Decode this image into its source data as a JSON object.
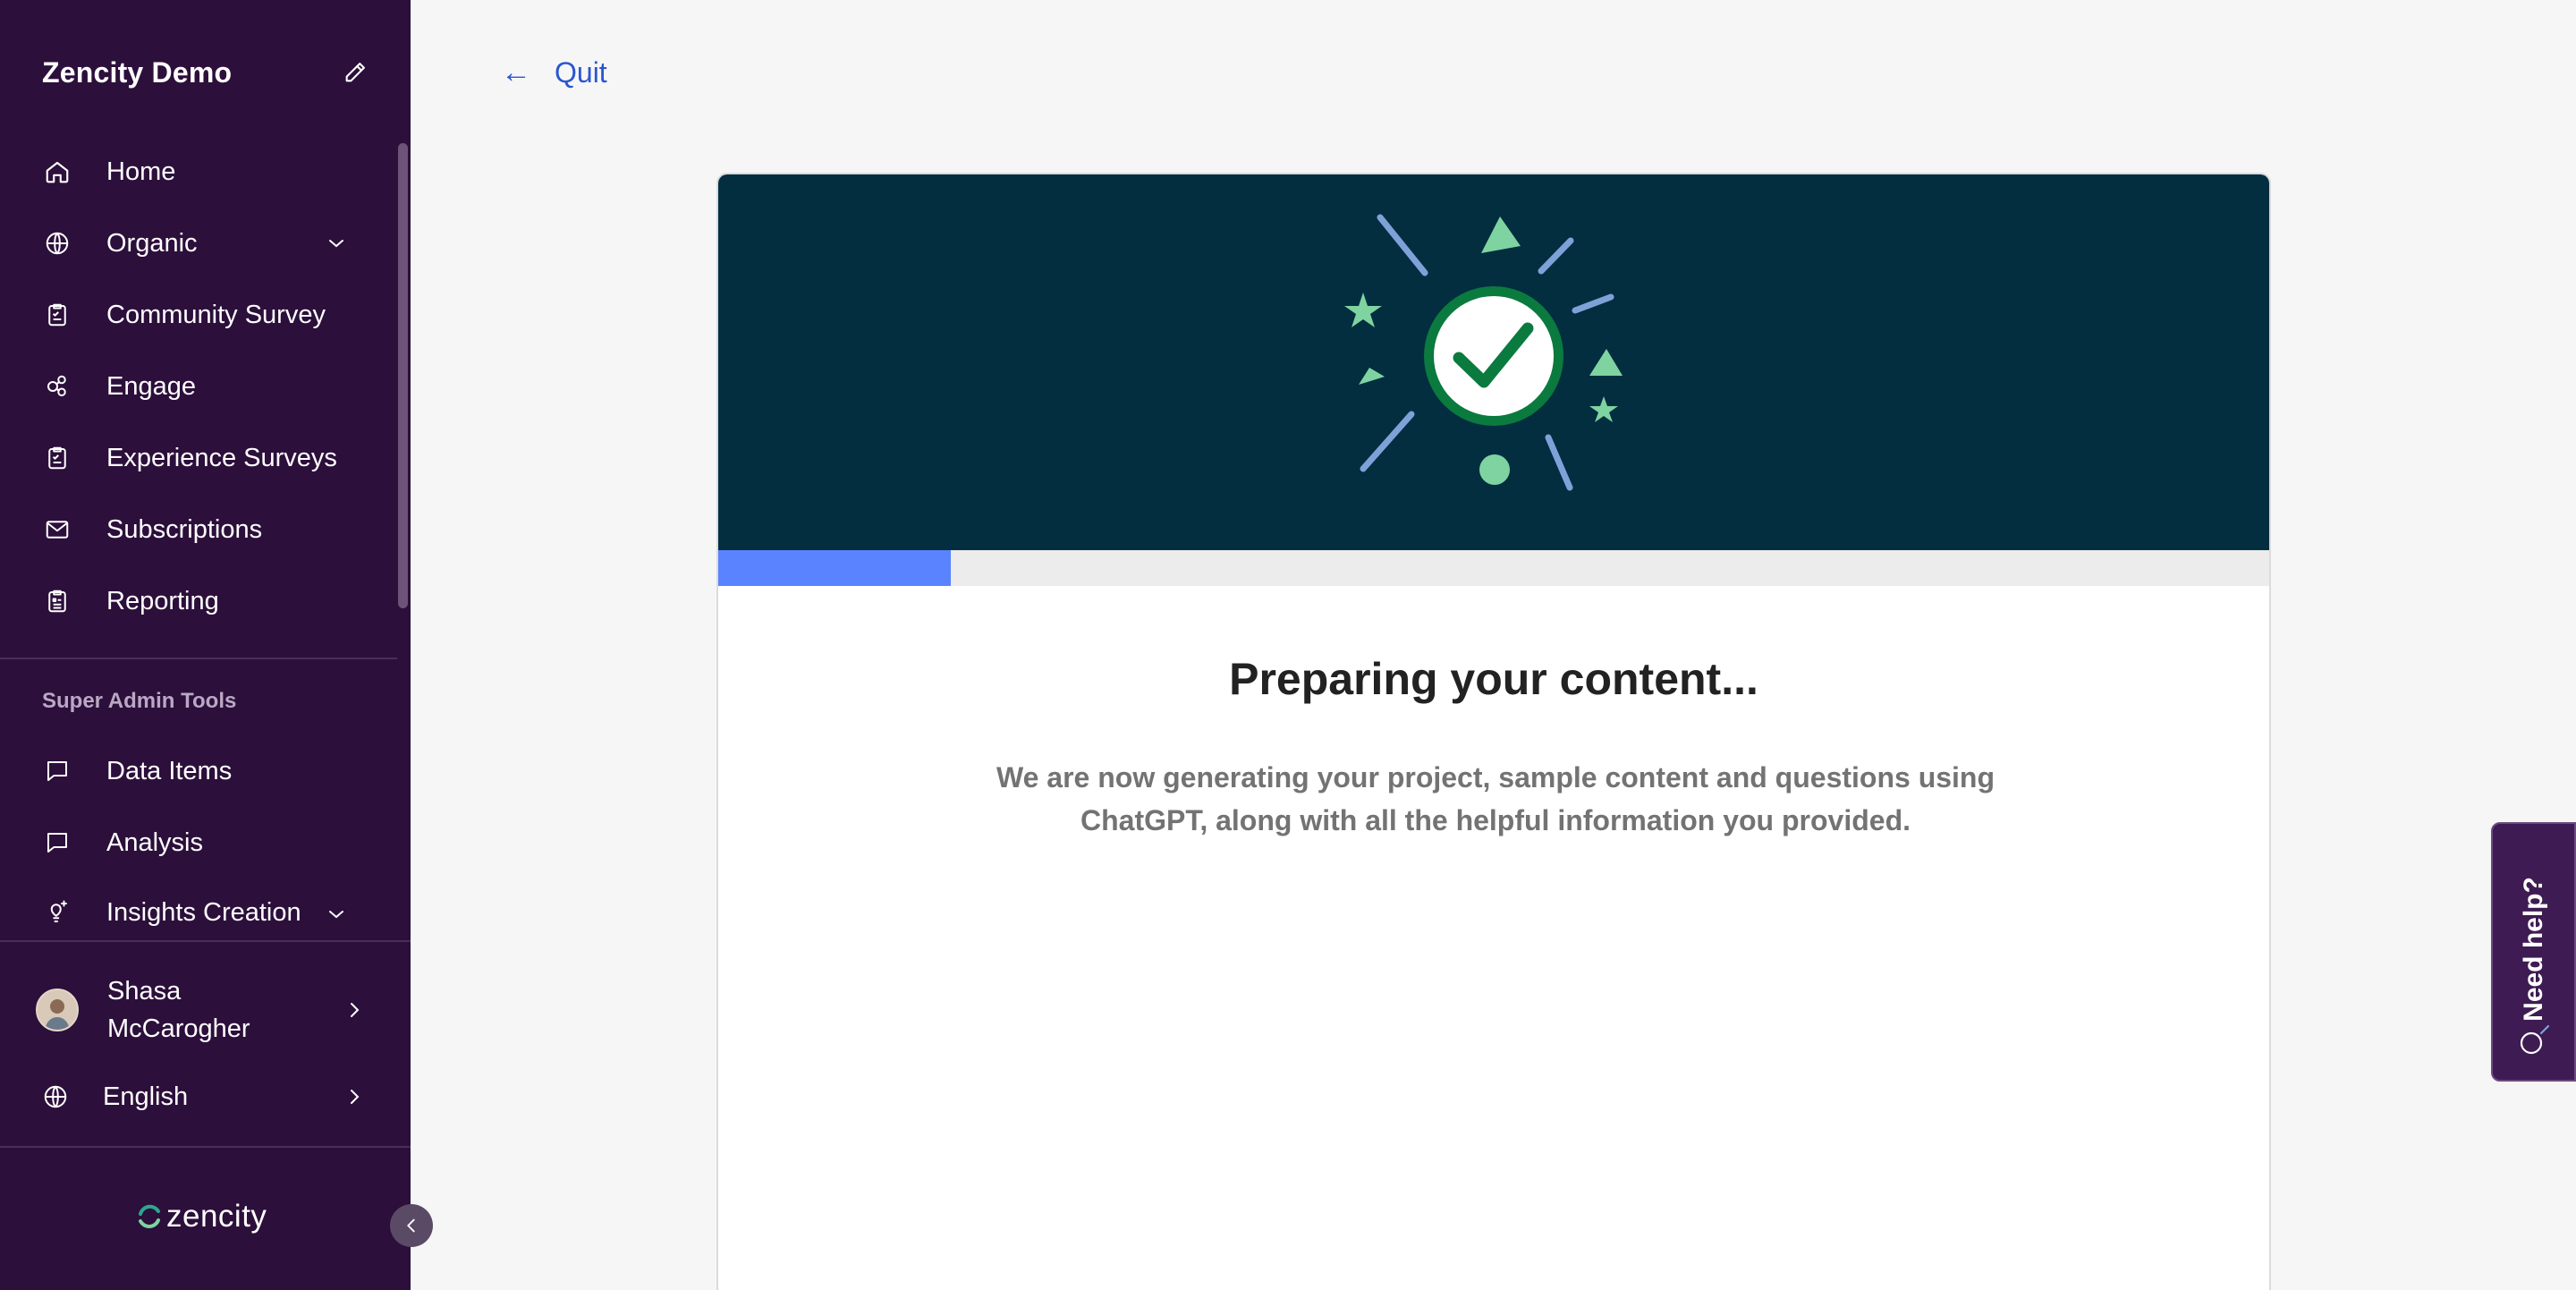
{
  "sidebar": {
    "title": "Zencity Demo",
    "items": [
      {
        "label": "Home",
        "icon": "home-icon"
      },
      {
        "label": "Organic",
        "icon": "globe-icon"
      },
      {
        "label": "Community Survey",
        "icon": "clipboard-icon"
      },
      {
        "label": "Engage",
        "icon": "engage-icon"
      },
      {
        "label": "Experience Surveys",
        "icon": "clipboard-icon"
      },
      {
        "label": "Subscriptions",
        "icon": "mail-icon"
      },
      {
        "label": "Reporting",
        "icon": "report-icon"
      }
    ],
    "section_title": "Super Admin Tools",
    "admin_items": [
      {
        "label": "Data Items",
        "icon": "chat-bubble-icon"
      },
      {
        "label": "Analysis",
        "icon": "chat-bubble-icon"
      },
      {
        "label": "Insights Creation",
        "icon": "lightbulb-icon"
      }
    ],
    "user_name": "Shasa McCarogher",
    "language": "English",
    "logo_text": "zencity"
  },
  "header": {
    "quit_label": "Quit"
  },
  "main": {
    "heading": "Preparing your content...",
    "description": "We are now generating your project, sample content and questions using ChatGPT, along with all the helpful information you provided.",
    "progress": 0.15
  },
  "help": {
    "label": "Need help?"
  },
  "colors": {
    "sidebar_bg": "#2c0f3b",
    "banner_bg": "#022e40",
    "progress": "#5a84ff",
    "accent_link": "#2a56d0",
    "success_green": "#0b7a3e",
    "confetti_green": "#7fd3a0",
    "confetti_blue": "#7ea2d8"
  }
}
